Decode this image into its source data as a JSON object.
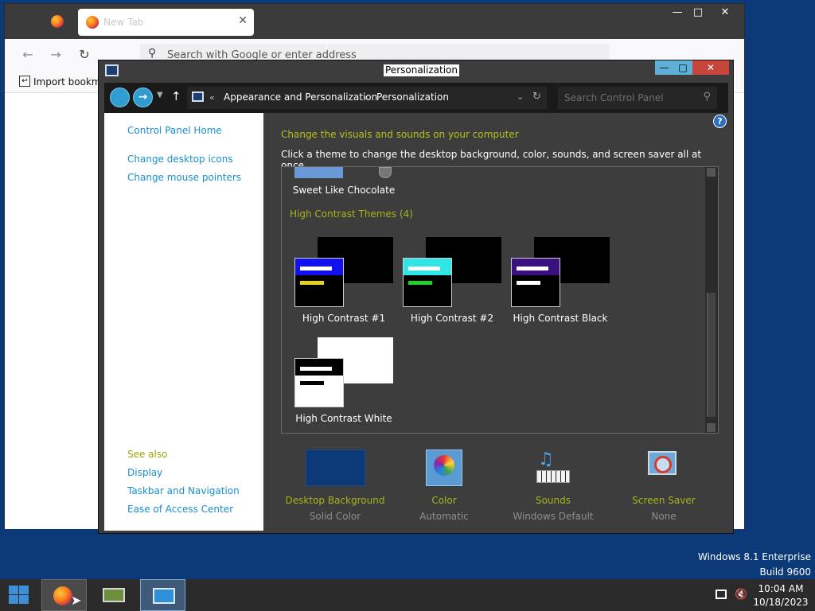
{
  "firefox": {
    "tab_title": "New Tab",
    "tab_close": "✕",
    "url_placeholder": "Search with Google or enter address",
    "bookmark_label": "Import bookmarks...",
    "min": "—",
    "max": "□",
    "close": "✕"
  },
  "window": {
    "title": "Personalization",
    "min": "—",
    "max": "□",
    "close": "✕"
  },
  "address": {
    "path_prefix": "«",
    "crumb1": "Appearance and Personalization",
    "crumb2": "Personalization",
    "separator": "›",
    "search_placeholder": "Search Control Panel"
  },
  "left_nav": {
    "home": "Control Panel Home",
    "links": [
      "Change desktop icons",
      "Change mouse pointers"
    ],
    "see_also_heading": "See also",
    "see_also": [
      "Display",
      "Taskbar and Navigation",
      "Ease of Access Center"
    ]
  },
  "main": {
    "heading": "Change the visuals and sounds on your computer",
    "subtitle": "Click a theme to change the desktop background, color, sounds, and screen saver all at once.",
    "help": "?"
  },
  "themes": {
    "partial_theme": "Sweet Like Chocolate",
    "hc_group": "High Contrast Themes (4)",
    "items": [
      {
        "label": "High Contrast #1",
        "back": "#000000",
        "front_top": "#1010f0",
        "bar1": "#ffffff",
        "bar2": "#e6d21a"
      },
      {
        "label": "High Contrast #2",
        "back": "#000000",
        "front_top": "#2ee6e6",
        "bar1": "#ffffff",
        "bar2": "#22d02a"
      },
      {
        "label": "High Contrast Black",
        "back": "#000000",
        "front_top": "#3a1080",
        "bar1": "#ffffff",
        "bar2": "#ffffff"
      },
      {
        "label": "High Contrast White",
        "back": "#ffffff",
        "front_top": "#000000",
        "bar1": "#ffffff",
        "bar2": "#000000"
      }
    ]
  },
  "bottom": [
    {
      "title": "Desktop Background",
      "sub": "Solid Color",
      "icon": "desktop-background-icon"
    },
    {
      "title": "Color",
      "sub": "Automatic",
      "icon": "color-icon"
    },
    {
      "title": "Sounds",
      "sub": "Windows Default",
      "icon": "sounds-icon"
    },
    {
      "title": "Screen Saver",
      "sub": "None",
      "icon": "screen-saver-icon"
    }
  ],
  "desktop": {
    "os_line1": "Windows 8.1 Enterprise",
    "os_line2": "Build 9600"
  },
  "taskbar": {
    "time": "10:04 AM",
    "date": "10/18/2023"
  },
  "colors": {
    "accent_link": "#1a8fd0",
    "accent_green": "#a7b518",
    "desktop": "#0c3a78"
  }
}
